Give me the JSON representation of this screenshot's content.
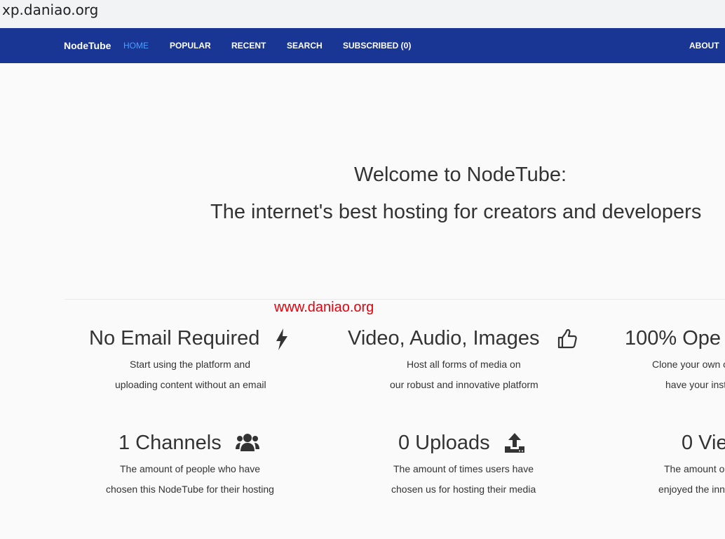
{
  "browser": {
    "url": "xp.daniao.org"
  },
  "navbar": {
    "brand": "NodeTube",
    "items": [
      {
        "label": "HOME"
      },
      {
        "label": "POPULAR"
      },
      {
        "label": "RECENT"
      },
      {
        "label": "SEARCH"
      },
      {
        "label": "SUBSCRIBED (0)"
      }
    ],
    "about": "ABOUT",
    "link_color": "#ffffff",
    "active_color": "#4a9fff",
    "background": "#1a3694"
  },
  "hero": {
    "line1": "Welcome to NodeTube:",
    "line2": "The internet's best hosting for creators and developers"
  },
  "watermark": "www.daniao.org",
  "features": [
    {
      "title": "No Email Required",
      "icon": "bolt-icon",
      "desc1": "Start using the platform and",
      "desc2": "uploading content without an email"
    },
    {
      "title": "Video, Audio, Images",
      "icon": "thumbs-up-icon",
      "desc1": "Host all forms of media on",
      "desc2": "our robust and innovative platform"
    },
    {
      "title": "100% Ope",
      "desc1": "Clone your own c",
      "desc2": "have your inst"
    }
  ],
  "stats": [
    {
      "title": "1 Channels",
      "icon": "users-icon",
      "desc1": "The amount of people who have",
      "desc2": "chosen this NodeTube for their hosting"
    },
    {
      "title": "0 Uploads",
      "icon": "upload-icon",
      "desc1": "The amount of times users have",
      "desc2": "chosen us for hosting their media"
    },
    {
      "title": "0 Vie",
      "desc1": "The amount o",
      "desc2": "enjoyed the inn"
    }
  ]
}
